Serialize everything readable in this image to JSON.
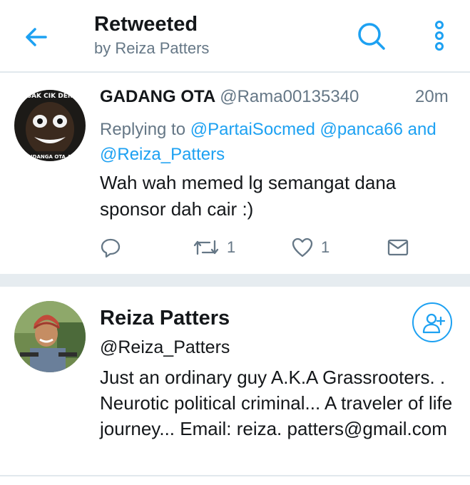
{
  "header": {
    "title": "Retweeted",
    "subtitle": "by Reiza Patters",
    "icons": {
      "back": "arrow-left-icon",
      "search": "search-icon",
      "more": "more-vertical-icon"
    },
    "accent": "#1da1f2"
  },
  "tweet": {
    "name": "GADANG OTA",
    "handle": "@Rama00135340",
    "time": "20m",
    "replying_prefix": "Replying to",
    "replying_to_1": "@PartaiSocmed",
    "replying_to_2": "@panca66",
    "replying_and": "and",
    "replying_to_3": "@Reiza_Patters",
    "text": "Wah wah memed lg semangat dana sponsor dah cair :)",
    "avatar_text_top": "SAK CIK DEN",
    "avatar_text_bottom": "ANDANGA OTA AN",
    "reply_count": "",
    "retweet_count": "1",
    "like_count": "1"
  },
  "profile": {
    "name": "Reiza Patters",
    "handle": "@Reiza_Patters",
    "bio": "Just an ordinary guy A.K.A Grassrooters. . Neurotic political criminal... A traveler of life journey... Email: reiza. patters@gmail.com",
    "follow_icon": "add-user-icon"
  }
}
